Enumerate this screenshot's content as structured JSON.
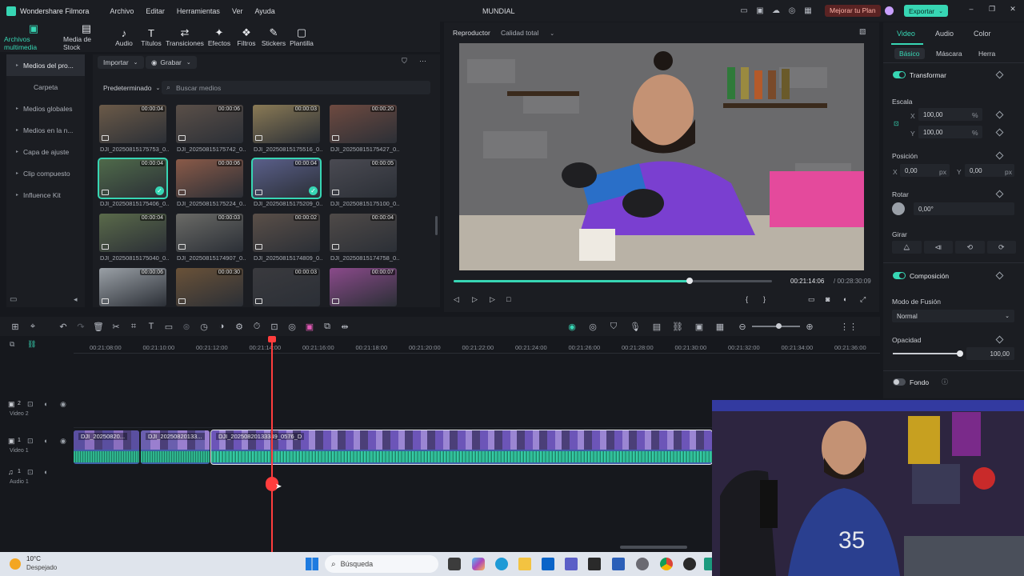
{
  "titlebar": {
    "app_name": "Wondershare Filmora",
    "menu": [
      "Archivo",
      "Editar",
      "Herramientas",
      "Ver",
      "Ayuda"
    ],
    "project_title": "MUNDIAL",
    "upgrade_label": "Mejorar tu Plan",
    "export_label": "Exportar"
  },
  "top_tabs": [
    {
      "label": "Archivos multimedia",
      "icon": "media-icon",
      "active": true
    },
    {
      "label": "Media de Stock",
      "icon": "stock-icon"
    },
    {
      "label": "Audio",
      "icon": "music-icon"
    },
    {
      "label": "Títulos",
      "icon": "text-icon"
    },
    {
      "label": "Transiciones",
      "icon": "transition-icon"
    },
    {
      "label": "Efectos",
      "icon": "effects-icon"
    },
    {
      "label": "Filtros",
      "icon": "filters-icon"
    },
    {
      "label": "Stickers",
      "icon": "stickers-icon"
    },
    {
      "label": "Plantilla",
      "icon": "template-icon"
    }
  ],
  "left_nav": {
    "items": [
      {
        "label": "Medios del pro...",
        "active": true,
        "arrow": true
      },
      {
        "label": "Carpeta",
        "arrow": false
      },
      {
        "label": "Medios globales",
        "arrow": true
      },
      {
        "label": "Medios en la n...",
        "arrow": true
      },
      {
        "label": "Capa de ajuste",
        "arrow": true
      },
      {
        "label": "Clip compuesto",
        "arrow": true
      },
      {
        "label": "Influence Kit",
        "arrow": true
      }
    ]
  },
  "media": {
    "import_label": "Importar",
    "record_label": "Grabar",
    "sort_label": "Predeterminado",
    "search_placeholder": "Buscar medios",
    "items": [
      {
        "name": "DJI_20250815175753_0...",
        "duration": "00:00:04",
        "color": "#6b5a48"
      },
      {
        "name": "DJI_20250815175742_0...",
        "duration": "00:00:06",
        "color": "#5a4f48"
      },
      {
        "name": "DJI_20250815175516_0...",
        "duration": "00:00:03",
        "color": "#8a7a55"
      },
      {
        "name": "DJI_20250815175427_0...",
        "duration": "00:00:20",
        "color": "#6e4a40"
      },
      {
        "name": "DJI_20250815175406_0...",
        "duration": "00:00:04",
        "color": "#4f6a4a",
        "selected": true
      },
      {
        "name": "DJI_20250815175224_0...",
        "duration": "00:00:06",
        "color": "#8a5a48"
      },
      {
        "name": "DJI_20250815175209_0...",
        "duration": "00:00:04",
        "color": "#5a5f8a",
        "selected": true
      },
      {
        "name": "DJI_20250815175100_0...",
        "duration": "00:00:05",
        "color": "#4a4a52"
      },
      {
        "name": "DJI_20250815175040_0...",
        "duration": "00:00:04",
        "color": "#5a6a4a"
      },
      {
        "name": "DJI_20250815174907_0...",
        "duration": "00:00:03",
        "color": "#6a6a66"
      },
      {
        "name": "DJI_20250815174809_0...",
        "duration": "00:00:02",
        "color": "#5a4f48"
      },
      {
        "name": "DJI_20250815174758_0...",
        "duration": "00:00:04",
        "color": "#4f4a48"
      },
      {
        "name": "",
        "duration": "00:00:06",
        "color": "#9aa0a6"
      },
      {
        "name": "",
        "duration": "00:00:30",
        "color": "#6a5238"
      },
      {
        "name": "",
        "duration": "00:00:03",
        "color": "#3a3a3e"
      },
      {
        "name": "",
        "duration": "00:00:07",
        "color": "#8a4a8a"
      }
    ]
  },
  "player": {
    "tab_label": "Reproductor",
    "quality_label": "Calidad total",
    "current_time": "00:21:14:06",
    "total_time": "/ 00:28:30:09",
    "progress": 0.74
  },
  "properties": {
    "tabs": [
      "Video",
      "Audio",
      "Color"
    ],
    "subtabs": [
      "Básico",
      "Máscara",
      "Herra"
    ],
    "transform_label": "Transformar",
    "scale_label": "Escala",
    "scale_x": "100,00",
    "scale_y": "100,00",
    "percent": "%",
    "position_label": "Posición",
    "pos_x": "0,00",
    "pos_y": "0,00",
    "px": "px",
    "rotate_label": "Rotar",
    "rotate_value": "0,00°",
    "flip_label": "Girar",
    "composition_label": "Composición",
    "blend_label": "Modo de Fusión",
    "blend_value": "Normal",
    "opacity_label": "Opacidad",
    "opacity_value": "100,00",
    "background_label": "Fondo",
    "x": "X",
    "y": "Y"
  },
  "timeline": {
    "ticks": [
      "00:21:08:00",
      "00:21:10:00",
      "00:21:12:00",
      "00:21:14:00",
      "00:21:16:00",
      "00:21:18:00",
      "00:21:20:00",
      "00:21:22:00",
      "00:21:24:00",
      "00:21:26:00",
      "00:21:28:00",
      "00:21:30:00",
      "00:21:32:00",
      "00:21:34:00",
      "00:21:36:00"
    ],
    "tracks": {
      "video2": "Video 2",
      "video1": "Video 1",
      "audio1": "Audio 1"
    },
    "clips": [
      {
        "name": "DJI_20250820..."
      },
      {
        "name": "DJI_20250820133..."
      },
      {
        "name": "DJI_20250820133349_0576_D"
      }
    ]
  },
  "taskbar": {
    "temp": "10°C",
    "weather": "Despejado",
    "search_placeholder": "Búsqueda"
  }
}
